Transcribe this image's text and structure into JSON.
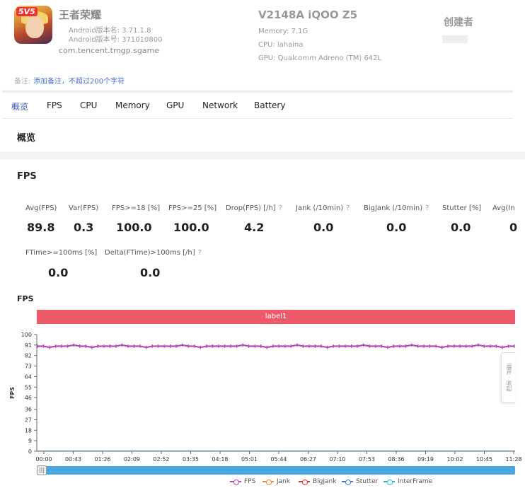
{
  "app": {
    "name": "王者荣耀",
    "version_name": "Android版本名: 3.71.1.8",
    "version_code": "Android版本号: 371010800",
    "package": "com.tencent.tmgp.sgame",
    "icon_badge": "5V5"
  },
  "device": {
    "name": "V2148A iQOO Z5",
    "memory": "Memory: 7.1G",
    "cpu": "CPU: lahaina",
    "gpu": "GPU: Qualcomm Adreno (TM) 642L"
  },
  "creator": {
    "label": "创建者"
  },
  "note": {
    "label": "备注:",
    "link": "添加备注，不超过200个字符"
  },
  "tabs": [
    "概览",
    "FPS",
    "CPU",
    "Memory",
    "GPU",
    "Network",
    "Battery"
  ],
  "active_tab": "概览",
  "section_title": "概览",
  "fps_card": {
    "title": "FPS",
    "metrics_row1": [
      {
        "label": "Avg(FPS)",
        "value": "89.8",
        "help": false
      },
      {
        "label": "Var(FPS)",
        "value": "0.3",
        "help": false
      },
      {
        "label": "FPS>=18 [%]",
        "value": "100.0",
        "help": false
      },
      {
        "label": "FPS>=25 [%]",
        "value": "100.0",
        "help": false
      },
      {
        "label": "Drop(FPS) [/h]",
        "value": "4.2",
        "help": true
      },
      {
        "label": "Jank (/10min)",
        "value": "0.0",
        "help": true
      },
      {
        "label": "BigJank (/10min)",
        "value": "0.0",
        "help": true
      },
      {
        "label": "Stutter [%]",
        "value": "0.0",
        "help": false
      },
      {
        "label": "Avg(In",
        "value": "0",
        "help": false
      }
    ],
    "metrics_row2": [
      {
        "label": "FTime>=100ms [%]",
        "value": "0.0",
        "help": false
      },
      {
        "label": "Delta(FTime)>100ms [/h]",
        "value": "0.0",
        "help": true
      }
    ],
    "help_glyph": "?"
  },
  "chart_data": {
    "type": "line",
    "title": "FPS",
    "ylabel": "FPS",
    "xlabel": "",
    "label_band": "label1",
    "y_ticks": [
      0,
      9,
      18,
      27,
      36,
      46,
      55,
      64,
      73,
      82,
      91,
      100
    ],
    "ylim": [
      0,
      100
    ],
    "x_ticks": [
      "00:00",
      "00:43",
      "01:26",
      "02:09",
      "02:52",
      "03:35",
      "04:18",
      "05:01",
      "05:44",
      "06:27",
      "07:10",
      "07:53",
      "08:36",
      "09:19",
      "10:02",
      "10:45",
      "11:28"
    ],
    "grid": false,
    "legend_position": "bottom",
    "series": [
      {
        "name": "FPS",
        "color": "#b44bb0",
        "baseline": 90,
        "values": [
          90,
          90,
          89,
          90,
          90,
          90,
          91,
          90,
          90,
          89,
          90,
          90,
          90,
          90,
          91,
          90,
          90,
          90,
          89,
          90,
          90,
          90,
          90,
          90,
          91,
          90,
          90,
          89,
          90,
          90,
          90,
          90,
          90,
          90,
          91,
          90,
          90,
          90,
          89,
          90,
          90,
          90,
          90,
          91,
          90,
          90,
          90,
          90,
          89,
          90,
          90,
          90,
          90,
          90,
          91,
          90,
          90,
          90,
          89,
          90,
          90,
          90,
          91,
          90,
          90,
          90,
          90,
          89,
          90,
          90,
          90,
          90,
          90,
          91,
          90,
          90,
          90,
          89,
          90,
          90
        ]
      },
      {
        "name": "Jank",
        "color": "#f08a3a",
        "values": []
      },
      {
        "name": "BigJank",
        "color": "#d93a3a",
        "values": []
      },
      {
        "name": "Stutter",
        "color": "#3a7bd9",
        "values": []
      },
      {
        "name": "InterFrame",
        "color": "#33b7d9",
        "values": []
      }
    ]
  },
  "side_tab_label": "展开 · 收起",
  "scroll_handle_glyph": "|||"
}
